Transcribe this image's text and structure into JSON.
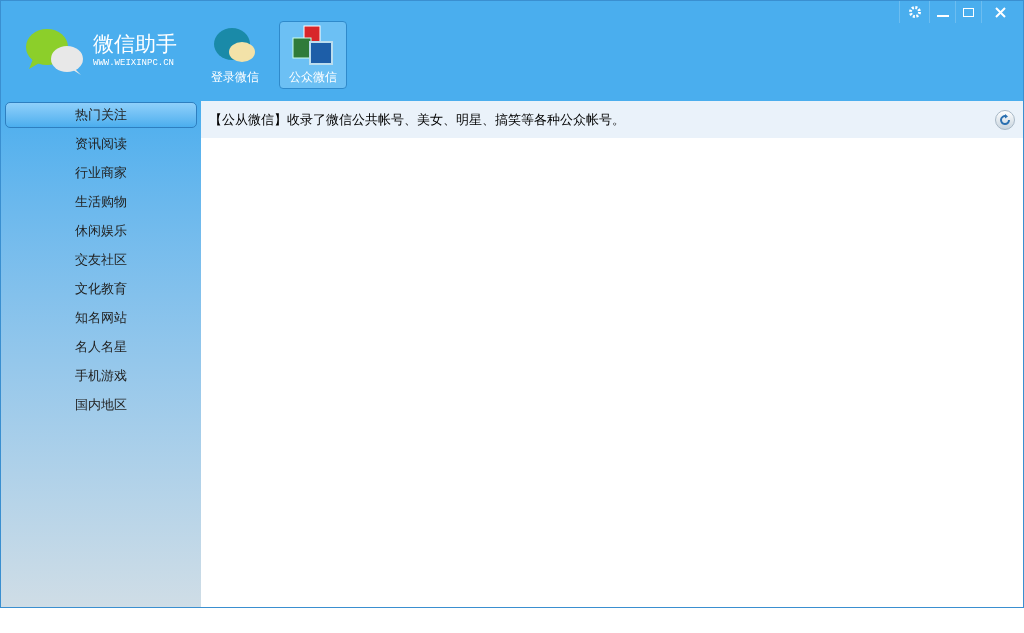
{
  "logo": {
    "title": "微信助手",
    "url": "WWW.WEIXINPC.CN"
  },
  "toolbar": [
    {
      "label": "登录微信",
      "kind": "login",
      "selected": false
    },
    {
      "label": "公众微信",
      "kind": "public",
      "selected": true
    }
  ],
  "sidebar": {
    "items": [
      {
        "label": "热门关注",
        "selected": true
      },
      {
        "label": "资讯阅读",
        "selected": false
      },
      {
        "label": "行业商家",
        "selected": false
      },
      {
        "label": "生活购物",
        "selected": false
      },
      {
        "label": "休闲娱乐",
        "selected": false
      },
      {
        "label": "交友社区",
        "selected": false
      },
      {
        "label": "文化教育",
        "selected": false
      },
      {
        "label": "知名网站",
        "selected": false
      },
      {
        "label": "名人名星",
        "selected": false
      },
      {
        "label": "手机游戏",
        "selected": false
      },
      {
        "label": "国内地区",
        "selected": false
      }
    ]
  },
  "info_bar": {
    "text": "【公从微信】收录了微信公共帐号、美女、明星、搞笑等各种公众帐号。"
  }
}
